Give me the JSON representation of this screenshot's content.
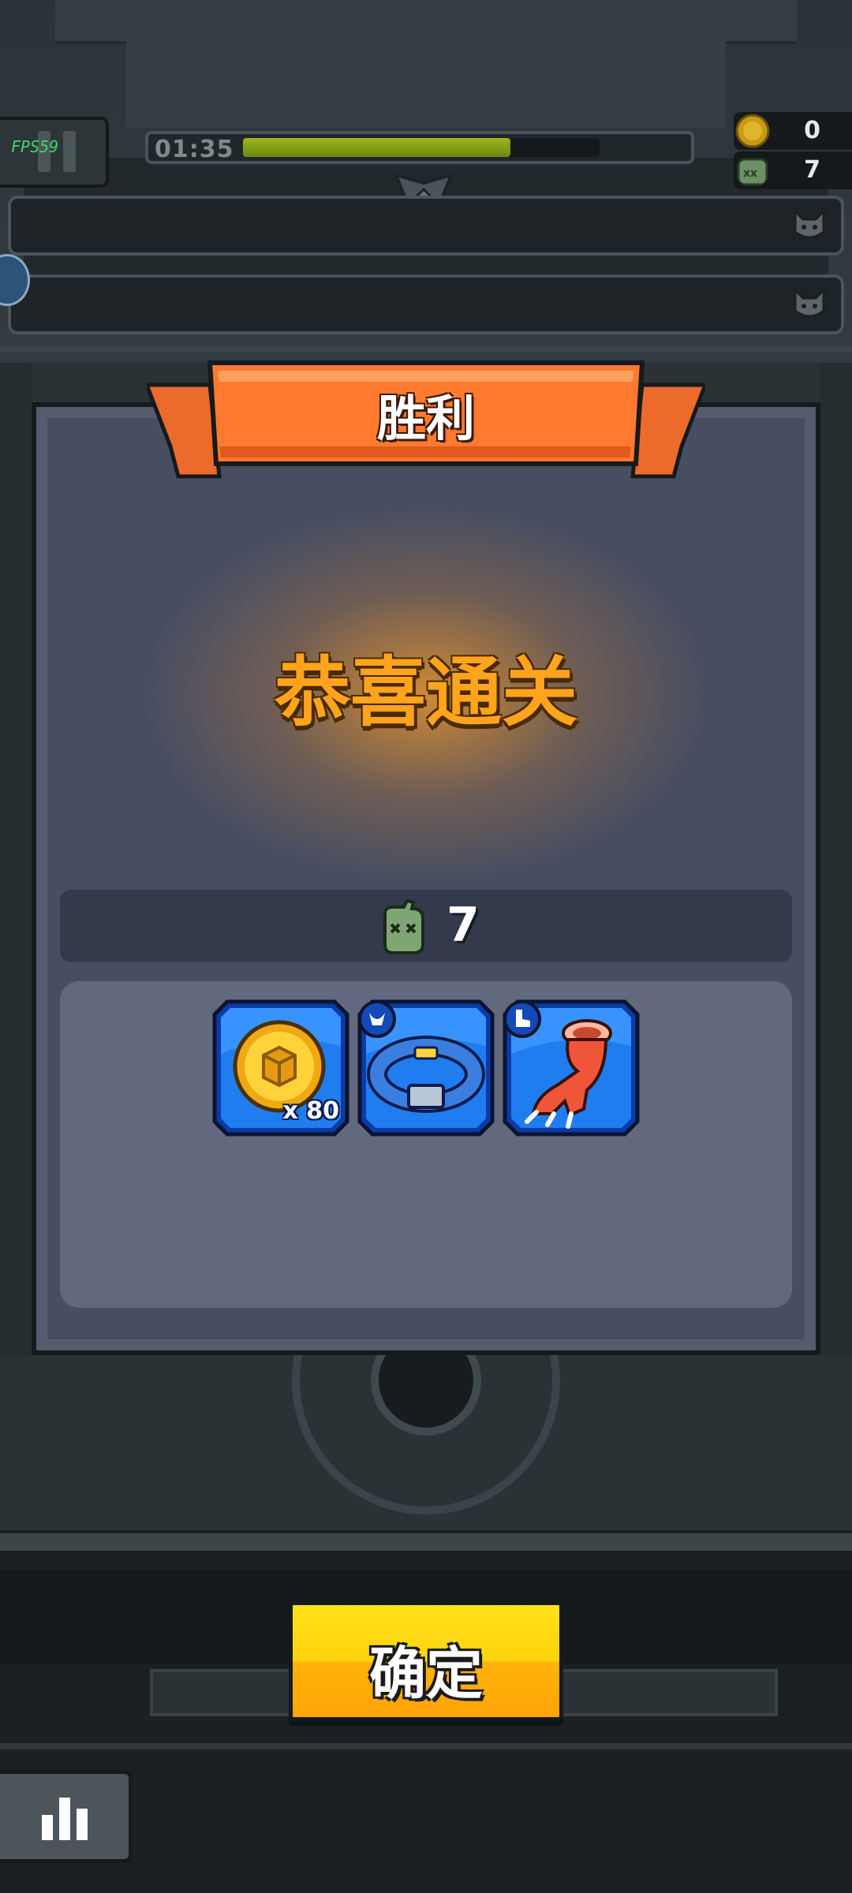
{
  "hud": {
    "fps_label": "FPS59",
    "timer": "01:35",
    "timer_progress": 0.75,
    "coins": "0",
    "kills": "7"
  },
  "dialog": {
    "title": "胜利",
    "message": "恭喜通关",
    "kill_count": "7",
    "rewards": [
      {
        "name": "gold-coin",
        "quantity": "x 80"
      },
      {
        "name": "blue-collar",
        "quantity": ""
      },
      {
        "name": "claw-boot",
        "quantity": ""
      }
    ]
  },
  "buttons": {
    "confirm": "确定"
  },
  "colors": {
    "ribbon": "#ff7a2e",
    "congrats_text": "#ffa41c",
    "confirm_button": "#ffd30e",
    "reward_tile": "#1f7df0"
  },
  "icons": [
    "pause-icon",
    "coin-icon",
    "zombie-icon",
    "cat-icon",
    "stats-icon",
    "rank-emblem-icon"
  ]
}
